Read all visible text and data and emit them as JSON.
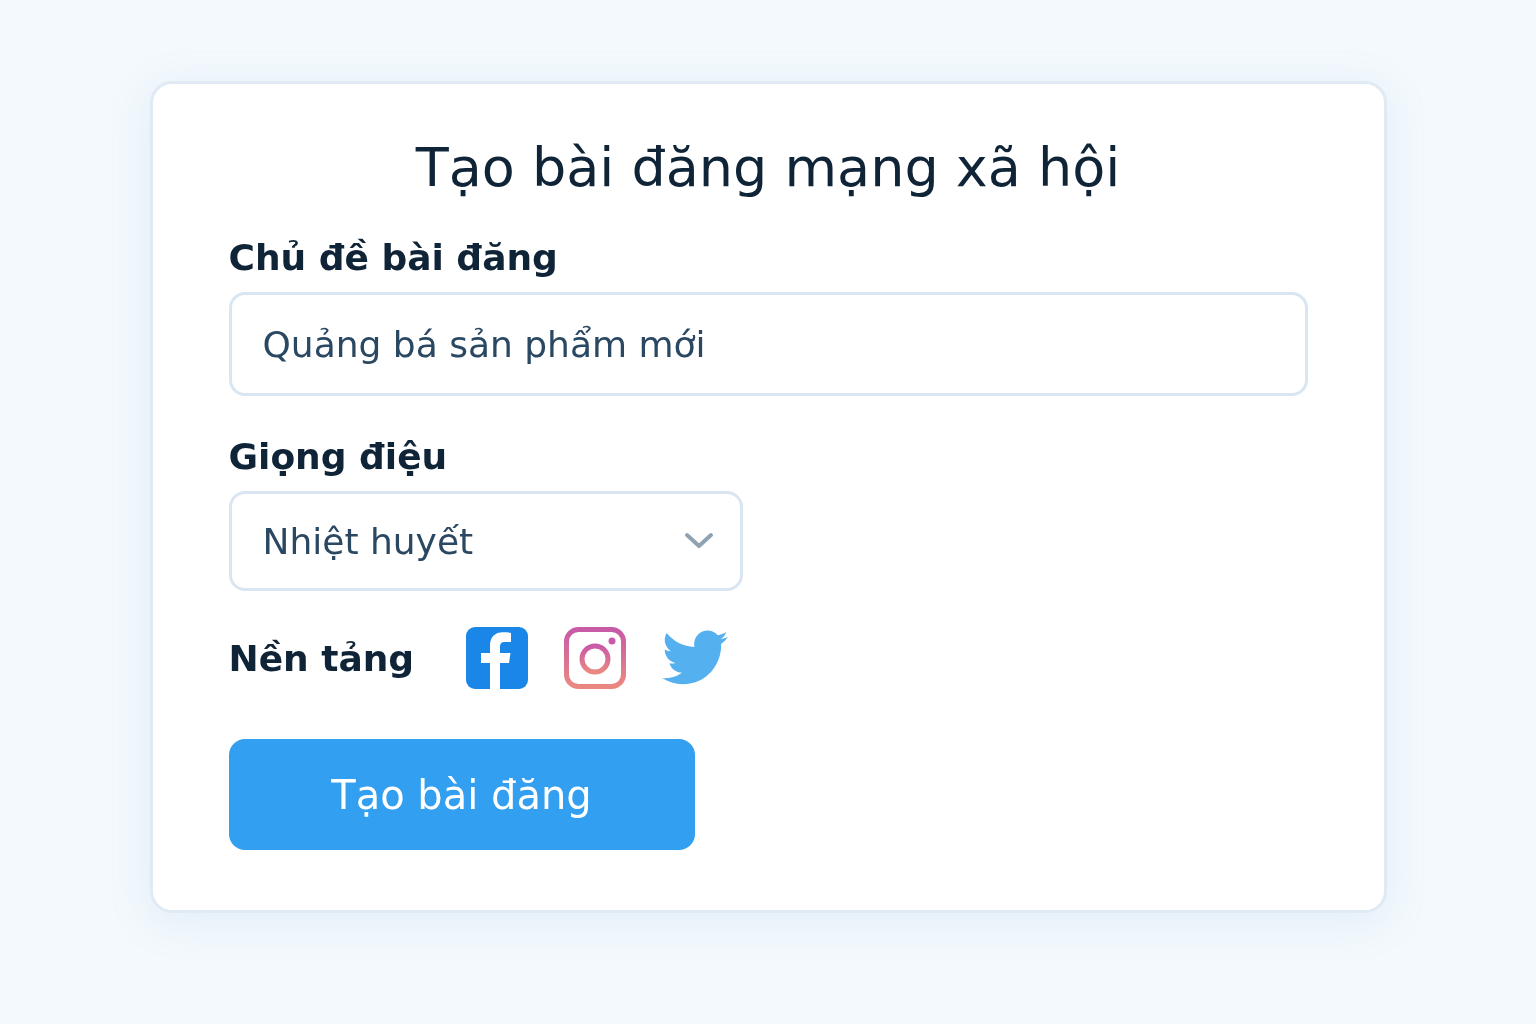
{
  "title": "Tạo bài đăng mạng xã hội",
  "topic": {
    "label": "Chủ đề bài đăng",
    "value": "Quảng bá sản phẩm mới"
  },
  "tone": {
    "label": "Giọng điệu",
    "value": "Nhiệt huyết"
  },
  "platforms": {
    "label": "Nền tảng",
    "items": [
      {
        "kind": "facebook"
      },
      {
        "kind": "instagram"
      },
      {
        "kind": "twitter"
      }
    ]
  },
  "submit": "Tạo bài đăng"
}
